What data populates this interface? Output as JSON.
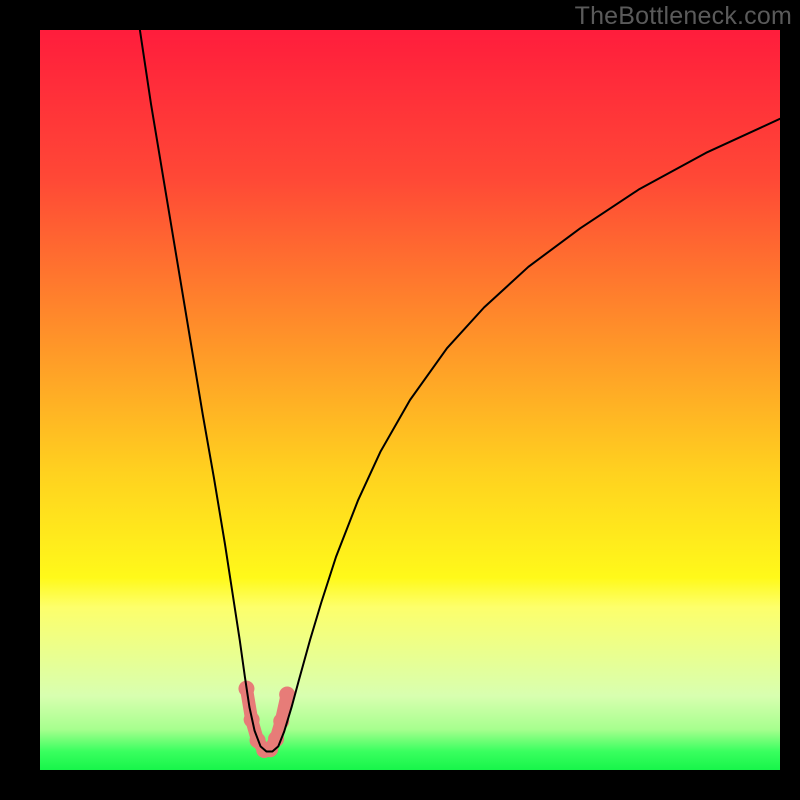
{
  "watermark": "TheBottleneck.com",
  "chart_data": {
    "type": "line",
    "title": "",
    "xlabel": "",
    "ylabel": "",
    "xlim": [
      0,
      100
    ],
    "ylim": [
      0,
      100
    ],
    "background_gradient": {
      "stops": [
        {
          "offset": 0.0,
          "color": "#ff1d3c"
        },
        {
          "offset": 0.2,
          "color": "#ff4836"
        },
        {
          "offset": 0.4,
          "color": "#ff8d2a"
        },
        {
          "offset": 0.6,
          "color": "#ffd21f"
        },
        {
          "offset": 0.74,
          "color": "#fff91a"
        },
        {
          "offset": 0.78,
          "color": "#fdff6b"
        },
        {
          "offset": 0.9,
          "color": "#d8ffb0"
        },
        {
          "offset": 0.945,
          "color": "#a7ff8e"
        },
        {
          "offset": 0.975,
          "color": "#39ff5f"
        },
        {
          "offset": 1.0,
          "color": "#17f54a"
        }
      ]
    },
    "series": [
      {
        "name": "bottleneck-curve",
        "stroke": "#000000",
        "x": [
          13.5,
          15,
          17,
          19,
          20.5,
          22,
          23.5,
          25,
          26,
          27,
          27.7,
          28.3,
          29,
          29.8,
          30.6,
          31.4,
          32.2,
          33,
          34,
          35,
          36.5,
          38,
          40,
          43,
          46,
          50,
          55,
          60,
          66,
          73,
          81,
          90,
          100
        ],
        "y": [
          100,
          90,
          78,
          66,
          57,
          48,
          39.5,
          30.5,
          24,
          17.5,
          12.5,
          8.5,
          5.3,
          3.2,
          2.5,
          2.5,
          3.2,
          5.2,
          8.5,
          12.2,
          17.6,
          22.6,
          28.8,
          36.5,
          43,
          50,
          57,
          62.5,
          68,
          73.2,
          78.5,
          83.4,
          88
        ]
      }
    ],
    "markers": {
      "name": "optimum-band",
      "color": "#e77c78",
      "points": [
        {
          "x": 27.9,
          "y": 11.0
        },
        {
          "x": 28.6,
          "y": 6.8
        },
        {
          "x": 29.4,
          "y": 4.0
        },
        {
          "x": 30.3,
          "y": 2.7
        },
        {
          "x": 31.1,
          "y": 2.8
        },
        {
          "x": 31.9,
          "y": 4.2
        },
        {
          "x": 32.6,
          "y": 6.6
        },
        {
          "x": 33.4,
          "y": 10.2
        }
      ]
    }
  }
}
